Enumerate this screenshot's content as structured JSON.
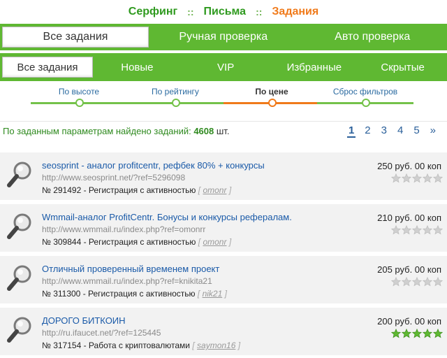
{
  "topnav": {
    "items": [
      {
        "label": "Серфинг",
        "active": false
      },
      {
        "label": "Письма",
        "active": false
      },
      {
        "label": "Задания",
        "active": true
      }
    ],
    "separator": "::"
  },
  "tabs_main": [
    {
      "label": "Все задания",
      "active": true
    },
    {
      "label": "Ручная проверка",
      "active": false
    },
    {
      "label": "Авто проверка",
      "active": false
    }
  ],
  "tabs_sub": [
    {
      "label": "Все задания",
      "active": true
    },
    {
      "label": "Новые",
      "active": false
    },
    {
      "label": "VIP",
      "active": false
    },
    {
      "label": "Избранные",
      "active": false
    },
    {
      "label": "Скрытые",
      "active": false
    }
  ],
  "filters": [
    {
      "label": "По высоте",
      "active": false
    },
    {
      "label": "По рейтингу",
      "active": false
    },
    {
      "label": "По цене",
      "active": true
    },
    {
      "label": "Сброс фильтров",
      "active": false
    }
  ],
  "results": {
    "text": "По заданным параметрам найдено заданий:",
    "count": "4608",
    "unit": "шт."
  },
  "pagination": {
    "pages": [
      "1",
      "2",
      "3",
      "4",
      "5",
      "»"
    ],
    "current": "1"
  },
  "tasks": [
    {
      "title": "seosprint - аналог profitcentr, рефбек 80% + конкурсы",
      "url": "http://www.seosprint.net/?ref=5296098",
      "number": "№ 291492",
      "meta": "- Регистрация с активностью",
      "user": "omonr",
      "price": "250 руб. 00 коп",
      "rating": 0
    },
    {
      "title": "Wmmail-аналог ProfitCentr. Бонусы и конкурсы рефералам.",
      "url": "http://www.wmmail.ru/index.php?ref=omonrr",
      "number": "№ 309844",
      "meta": "- Регистрация с активностью",
      "user": "omonr",
      "price": "210 руб. 00 коп",
      "rating": 0
    },
    {
      "title": "Отличный проверенный временем проект",
      "url": "http://www.wmmail.ru/index.php?ref=knikita21",
      "number": "№ 311300",
      "meta": "- Регистрация с активностью",
      "user": "nik21",
      "price": "205 руб. 00 коп",
      "rating": 0
    },
    {
      "title": "ДОРОГО БИТКОИН",
      "url": "http://ru.ifaucet.net/?ref=125445",
      "number": "№ 317154",
      "meta": "- Работа с криптовалютами",
      "user": "saymon16",
      "price": "200 руб. 00 коп",
      "rating": 5
    }
  ],
  "colors": {
    "brand_green": "#5fb832",
    "active_orange": "#f07a1a",
    "link_blue": "#1a5aa8",
    "star_on": "#5fb832",
    "star_off": "#d0d0d0"
  },
  "icons": {
    "task": "magnifier-icon",
    "rating": "star-icon"
  }
}
